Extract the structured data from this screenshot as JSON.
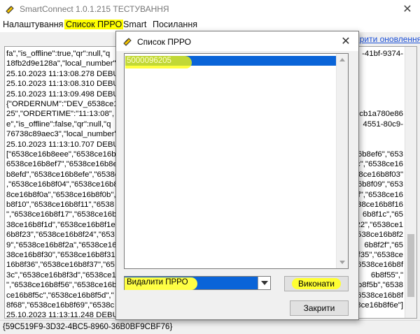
{
  "window": {
    "title": "SmartConnect 1.0.1.215 ТЕСТУВАННЯ",
    "close_glyph": "✕",
    "icon": "link-icon"
  },
  "menu": {
    "items": [
      "Налаштування",
      "Список ПРРО",
      "Smart",
      "Посилання"
    ],
    "highlighted": "Список ПРРО"
  },
  "update_link": "евірити оновлення",
  "log": {
    "left_lines": [
      "fa\",\"is_offline\":true,\"qr\":null,\"q",
      "18fb2d9e128a\",\"local_number\":",
      "25.10.2023 11:13:08.278 DEBU",
      "25.10.2023 11:13:08.310 DEBU",
      "25.10.2023 11:13:09.498 DEBU",
      "{\"ORDERNUM\":\"DEV_6538ce15",
      "25\",\"ORDERTIME\":\"11:13:08\",",
      "e\",\"is_offline\":false,\"qr\":null,\"q",
      "76738c89aec3\",\"local_number\":",
      "25.10.2023 11:13:10.707 DEBU",
      "[\"6538ce16b8eee\",\"6538ce16b",
      "6538ce16b8ef7\",\"6538ce16b8ef8\",",
      "b8efd\",\"6538ce16b8efe\",\"6538c",
      ",\"6538ce16b8f04\",\"6538ce16b8",
      "8ce16b8f0a\",\"6538ce16b8f0b\",",
      "b8f10\",\"6538ce16b8f11\",\"6538",
      "\",\"6538ce16b8f17\",\"6538ce16b",
      "38ce16b8f1d\",\"6538ce16b8f1e\"",
      "6b8f23\",\"6538ce16b8f24\",\"653",
      "9\",\"6538ce16b8f2a\",\"6538ce16",
      "38ce16b8f30\",\"6538ce16b8f31\"",
      "16b8f36\",\"6538ce16b8f37\",\"65",
      "3c\",\"6538ce16b8f3d\",\"6538ce1",
      "\",\"6538ce16b8f56\",\"6538ce16b8f",
      "ce16b8f5c\",\"6538ce16b8f5d\",\"",
      "8f68\",\"6538ce16b8f69\",\"6538c",
      "25.10.2023 11:13:11.248 DEBU"
    ],
    "right_lines": [
      "-41bf-9374-",
      "",
      "",
      "",
      "",
      "",
      "0cb1a780e86",
      "4551-80c9-",
      "",
      "",
      "6b8ef6\",\"653",
      "c\",\"6538ce16",
      "\"6538ce16b8f03\"",
      "6b8f09\",\"653",
      "0f\",\"6538ce16",
      "\"6538ce16b8f16",
      "6b8f1c\",\"65",
      "f22\",\"6538ce1",
      "\"6538ce16b8f2",
      "6b8f2f\",\"65",
      "f35\",\"6538ce",
      "\"6538ce16b8f",
      "6b8f55\",\"",
      "6b8f5b\",\"6538",
      "\"6538ce16b8f",
      "38ce16b8f6e\"]",
      ""
    ]
  },
  "status_text": "{59C519F9-3D32-4BC5-8960-36B0BF9CBF76}",
  "dialog": {
    "title": "Список ПРРО",
    "close_glyph": "✕",
    "icon": "link-icon",
    "list_items": [
      "5000096205"
    ],
    "action_select": {
      "value": "Видалити ПРРО"
    },
    "execute_label": "Виконати",
    "close_label": "Закрити"
  },
  "colors": {
    "highlight": "#ffff00",
    "selection": "#0a64d8",
    "link": "#1a4fd6"
  }
}
